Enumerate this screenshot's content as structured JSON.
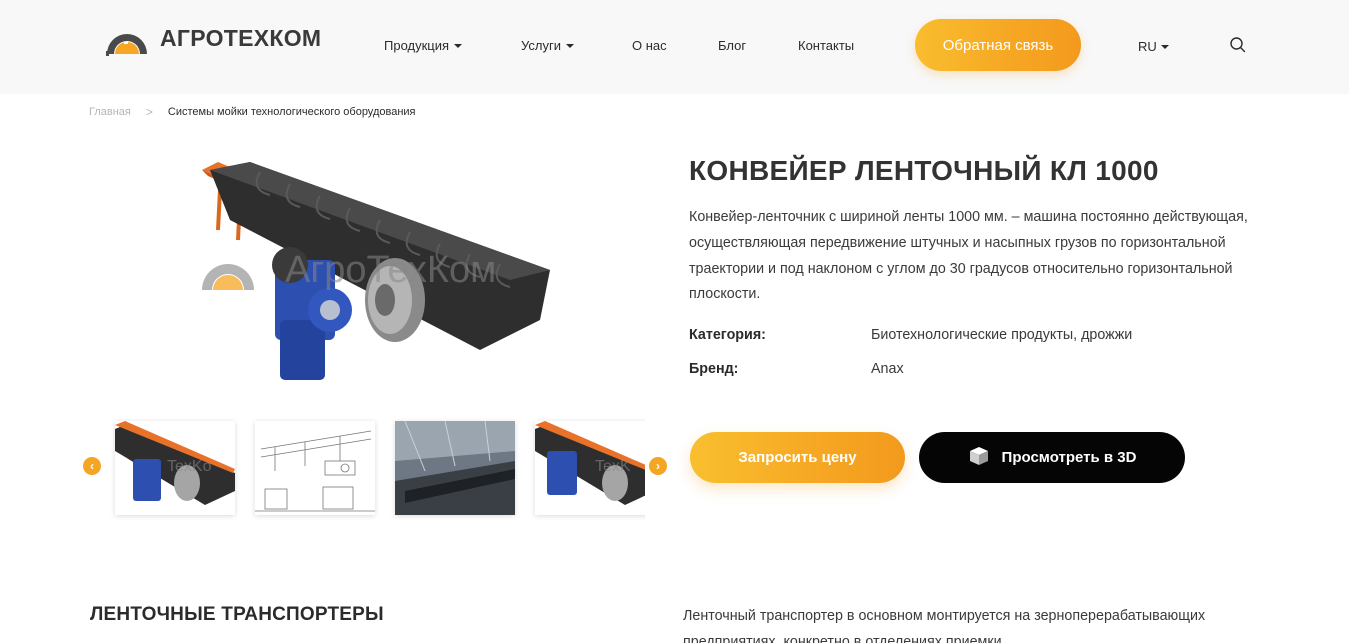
{
  "header": {
    "logo_text": "АГРОТЕХКОМ",
    "nav": [
      {
        "label": "Продукция",
        "has_dropdown": true
      },
      {
        "label": "Услуги",
        "has_dropdown": true
      },
      {
        "label": "О нас",
        "has_dropdown": false
      },
      {
        "label": "Блог",
        "has_dropdown": false
      },
      {
        "label": "Контакты",
        "has_dropdown": false
      }
    ],
    "cta_label": "Обратная связь",
    "language": "RU",
    "search_icon": "search-icon"
  },
  "breadcrumb": {
    "home": "Главная",
    "separator": ">",
    "current": "Системы мойки технологического оборудования"
  },
  "gallery": {
    "watermark": "АгроТехКом",
    "prev_icon": "chevron-left-icon",
    "next_icon": "chevron-right-icon",
    "thumbnails": [
      "conveyor-photo",
      "conveyor-drawing",
      "conveyor-installed-photo",
      "conveyor-photo"
    ]
  },
  "product": {
    "title": "КОНВЕЙЕР ЛЕНТОЧНЫЙ КЛ 1000",
    "description": "Конвейер-ленточник с шириной ленты 1000 мм. – машина постоянно действующая, осуществляющая передвижение штучных и насыпных грузов по горизонтальной траектории и под наклоном с углом до 30 градусов относительно горизонтальной плоскости.",
    "category_label": "Категория:",
    "category_value": "Биотехнологические продукты, дрожжи",
    "brand_label": "Бренд:",
    "brand_value": "Anax",
    "price_button": "Запросить цену",
    "view3d_button": "Просмотреть в 3D"
  },
  "section": {
    "title": "ЛЕНТОЧНЫЕ ТРАНСПОРТЕРЫ",
    "text": "Ленточный транспортер в основном монтируется на зерноперерабатывающих предприятиях, конкретно в отделениях приемки"
  },
  "colors": {
    "accent": "#f6a623",
    "accent_light": "#f9bd2f",
    "dark_button": "#050505",
    "header_bg": "#f8f8f8",
    "text": "#2b2b2b"
  }
}
